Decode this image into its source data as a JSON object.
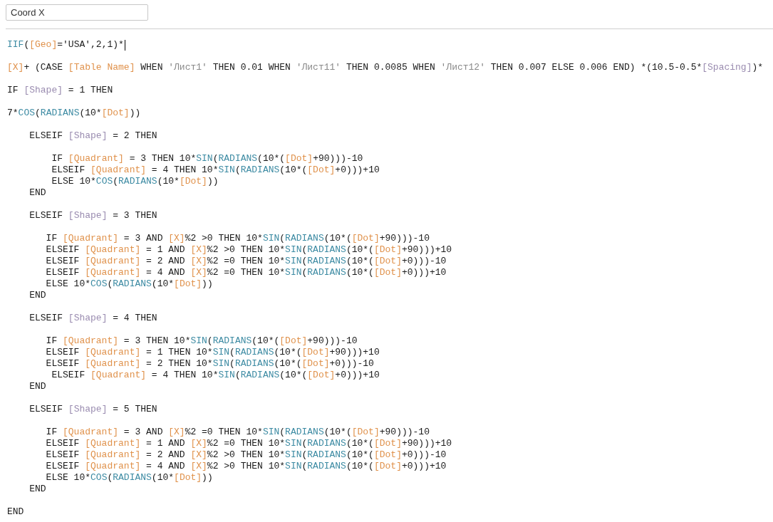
{
  "name_field": {
    "value": "Coord X"
  },
  "code_blocks": [
    [
      {
        "cursor": true,
        "tokens": [
          {
            "kind": "function",
            "text": "IIF"
          },
          {
            "kind": "plain",
            "text": "("
          },
          {
            "kind": "field",
            "text": "[Geo]"
          },
          {
            "kind": "plain",
            "text": "='USA',2,1)*"
          }
        ]
      }
    ],
    [
      {
        "cursor": false,
        "tokens": [
          {
            "kind": "field",
            "text": "[X]"
          },
          {
            "kind": "plain",
            "text": "+ (CASE "
          },
          {
            "kind": "field",
            "text": "[Table Name]"
          },
          {
            "kind": "plain",
            "text": " WHEN "
          },
          {
            "kind": "string",
            "text": "'Лист1'"
          },
          {
            "kind": "plain",
            "text": " THEN 0.01 WHEN "
          },
          {
            "kind": "string",
            "text": "'Лист11'"
          },
          {
            "kind": "plain",
            "text": " THEN 0.0085 WHEN "
          },
          {
            "kind": "string",
            "text": "'Лист12'"
          },
          {
            "kind": "plain",
            "text": " THEN 0.007 ELSE 0.006 END) *(10.5-0.5*"
          },
          {
            "kind": "parameter",
            "text": "[Spacing]"
          },
          {
            "kind": "plain",
            "text": ")*"
          }
        ]
      }
    ],
    [
      {
        "cursor": false,
        "tokens": [
          {
            "kind": "plain",
            "text": "IF "
          },
          {
            "kind": "parameter",
            "text": "[Shape]"
          },
          {
            "kind": "plain",
            "text": " = 1 THEN"
          }
        ]
      }
    ],
    [
      {
        "cursor": false,
        "tokens": [
          {
            "kind": "plain",
            "text": "7*"
          },
          {
            "kind": "function",
            "text": "COS"
          },
          {
            "kind": "plain",
            "text": "("
          },
          {
            "kind": "function",
            "text": "RADIANS"
          },
          {
            "kind": "plain",
            "text": "(10*"
          },
          {
            "kind": "field",
            "text": "[Dot]"
          },
          {
            "kind": "plain",
            "text": "))"
          }
        ]
      }
    ],
    [
      {
        "cursor": false,
        "tokens": [
          {
            "kind": "plain",
            "text": "    ELSEIF "
          },
          {
            "kind": "parameter",
            "text": "[Shape]"
          },
          {
            "kind": "plain",
            "text": " = 2 THEN"
          }
        ]
      }
    ],
    [
      {
        "cursor": false,
        "tokens": [
          {
            "kind": "plain",
            "text": "        IF "
          },
          {
            "kind": "field",
            "text": "[Quadrant]"
          },
          {
            "kind": "plain",
            "text": " = 3 THEN 10*"
          },
          {
            "kind": "function",
            "text": "SIN"
          },
          {
            "kind": "plain",
            "text": "("
          },
          {
            "kind": "function",
            "text": "RADIANS"
          },
          {
            "kind": "plain",
            "text": "(10*("
          },
          {
            "kind": "field",
            "text": "[Dot]"
          },
          {
            "kind": "plain",
            "text": "+90)))-10"
          }
        ]
      },
      {
        "cursor": false,
        "tokens": [
          {
            "kind": "plain",
            "text": "        ELSEIF "
          },
          {
            "kind": "field",
            "text": "[Quadrant]"
          },
          {
            "kind": "plain",
            "text": " = 4 THEN 10*"
          },
          {
            "kind": "function",
            "text": "SIN"
          },
          {
            "kind": "plain",
            "text": "("
          },
          {
            "kind": "function",
            "text": "RADIANS"
          },
          {
            "kind": "plain",
            "text": "(10*("
          },
          {
            "kind": "field",
            "text": "[Dot]"
          },
          {
            "kind": "plain",
            "text": "+0)))+10"
          }
        ]
      },
      {
        "cursor": false,
        "tokens": [
          {
            "kind": "plain",
            "text": "        ELSE 10*"
          },
          {
            "kind": "function",
            "text": "COS"
          },
          {
            "kind": "plain",
            "text": "("
          },
          {
            "kind": "function",
            "text": "RADIANS"
          },
          {
            "kind": "plain",
            "text": "(10*"
          },
          {
            "kind": "field",
            "text": "[Dot]"
          },
          {
            "kind": "plain",
            "text": "))"
          }
        ]
      },
      {
        "cursor": false,
        "tokens": [
          {
            "kind": "plain",
            "text": "    END"
          }
        ]
      }
    ],
    [
      {
        "cursor": false,
        "tokens": [
          {
            "kind": "plain",
            "text": "    ELSEIF "
          },
          {
            "kind": "parameter",
            "text": "[Shape]"
          },
          {
            "kind": "plain",
            "text": " = 3 THEN"
          }
        ]
      }
    ],
    [
      {
        "cursor": false,
        "tokens": [
          {
            "kind": "plain",
            "text": "       IF "
          },
          {
            "kind": "field",
            "text": "[Quadrant]"
          },
          {
            "kind": "plain",
            "text": " = 3 AND "
          },
          {
            "kind": "field",
            "text": "[X]"
          },
          {
            "kind": "plain",
            "text": "%2 >0 THEN 10*"
          },
          {
            "kind": "function",
            "text": "SIN"
          },
          {
            "kind": "plain",
            "text": "("
          },
          {
            "kind": "function",
            "text": "RADIANS"
          },
          {
            "kind": "plain",
            "text": "(10*("
          },
          {
            "kind": "field",
            "text": "[Dot]"
          },
          {
            "kind": "plain",
            "text": "+90)))-10"
          }
        ]
      },
      {
        "cursor": false,
        "tokens": [
          {
            "kind": "plain",
            "text": "       ELSEIF "
          },
          {
            "kind": "field",
            "text": "[Quadrant]"
          },
          {
            "kind": "plain",
            "text": " = 1 AND "
          },
          {
            "kind": "field",
            "text": "[X]"
          },
          {
            "kind": "plain",
            "text": "%2 >0 THEN 10*"
          },
          {
            "kind": "function",
            "text": "SIN"
          },
          {
            "kind": "plain",
            "text": "("
          },
          {
            "kind": "function",
            "text": "RADIANS"
          },
          {
            "kind": "plain",
            "text": "(10*("
          },
          {
            "kind": "field",
            "text": "[Dot]"
          },
          {
            "kind": "plain",
            "text": "+90)))+10"
          }
        ]
      },
      {
        "cursor": false,
        "tokens": [
          {
            "kind": "plain",
            "text": "       ELSEIF "
          },
          {
            "kind": "field",
            "text": "[Quadrant]"
          },
          {
            "kind": "plain",
            "text": " = 2 AND "
          },
          {
            "kind": "field",
            "text": "[X]"
          },
          {
            "kind": "plain",
            "text": "%2 =0 THEN 10*"
          },
          {
            "kind": "function",
            "text": "SIN"
          },
          {
            "kind": "plain",
            "text": "("
          },
          {
            "kind": "function",
            "text": "RADIANS"
          },
          {
            "kind": "plain",
            "text": "(10*("
          },
          {
            "kind": "field",
            "text": "[Dot]"
          },
          {
            "kind": "plain",
            "text": "+0)))-10"
          }
        ]
      },
      {
        "cursor": false,
        "tokens": [
          {
            "kind": "plain",
            "text": "       ELSEIF "
          },
          {
            "kind": "field",
            "text": "[Quadrant]"
          },
          {
            "kind": "plain",
            "text": " = 4 AND "
          },
          {
            "kind": "field",
            "text": "[X]"
          },
          {
            "kind": "plain",
            "text": "%2 =0 THEN 10*"
          },
          {
            "kind": "function",
            "text": "SIN"
          },
          {
            "kind": "plain",
            "text": "("
          },
          {
            "kind": "function",
            "text": "RADIANS"
          },
          {
            "kind": "plain",
            "text": "(10*("
          },
          {
            "kind": "field",
            "text": "[Dot]"
          },
          {
            "kind": "plain",
            "text": "+0)))+10"
          }
        ]
      },
      {
        "cursor": false,
        "tokens": [
          {
            "kind": "plain",
            "text": "       ELSE 10*"
          },
          {
            "kind": "function",
            "text": "COS"
          },
          {
            "kind": "plain",
            "text": "("
          },
          {
            "kind": "function",
            "text": "RADIANS"
          },
          {
            "kind": "plain",
            "text": "(10*"
          },
          {
            "kind": "field",
            "text": "[Dot]"
          },
          {
            "kind": "plain",
            "text": "))"
          }
        ]
      },
      {
        "cursor": false,
        "tokens": [
          {
            "kind": "plain",
            "text": "    END"
          }
        ]
      }
    ],
    [
      {
        "cursor": false,
        "tokens": [
          {
            "kind": "plain",
            "text": "    ELSEIF "
          },
          {
            "kind": "parameter",
            "text": "[Shape]"
          },
          {
            "kind": "plain",
            "text": " = 4 THEN"
          }
        ]
      }
    ],
    [
      {
        "cursor": false,
        "tokens": [
          {
            "kind": "plain",
            "text": "       IF "
          },
          {
            "kind": "field",
            "text": "[Quadrant]"
          },
          {
            "kind": "plain",
            "text": " = 3 THEN 10*"
          },
          {
            "kind": "function",
            "text": "SIN"
          },
          {
            "kind": "plain",
            "text": "("
          },
          {
            "kind": "function",
            "text": "RADIANS"
          },
          {
            "kind": "plain",
            "text": "(10*("
          },
          {
            "kind": "field",
            "text": "[Dot]"
          },
          {
            "kind": "plain",
            "text": "+90)))-10"
          }
        ]
      },
      {
        "cursor": false,
        "tokens": [
          {
            "kind": "plain",
            "text": "       ELSEIF "
          },
          {
            "kind": "field",
            "text": "[Quadrant]"
          },
          {
            "kind": "plain",
            "text": " = 1 THEN 10*"
          },
          {
            "kind": "function",
            "text": "SIN"
          },
          {
            "kind": "plain",
            "text": "("
          },
          {
            "kind": "function",
            "text": "RADIANS"
          },
          {
            "kind": "plain",
            "text": "(10*("
          },
          {
            "kind": "field",
            "text": "[Dot]"
          },
          {
            "kind": "plain",
            "text": "+90)))+10"
          }
        ]
      },
      {
        "cursor": false,
        "tokens": [
          {
            "kind": "plain",
            "text": "       ELSEIF "
          },
          {
            "kind": "field",
            "text": "[Quadrant]"
          },
          {
            "kind": "plain",
            "text": " = 2 THEN 10*"
          },
          {
            "kind": "function",
            "text": "SIN"
          },
          {
            "kind": "plain",
            "text": "("
          },
          {
            "kind": "function",
            "text": "RADIANS"
          },
          {
            "kind": "plain",
            "text": "(10*("
          },
          {
            "kind": "field",
            "text": "[Dot]"
          },
          {
            "kind": "plain",
            "text": "+0)))-10"
          }
        ]
      },
      {
        "cursor": false,
        "tokens": [
          {
            "kind": "plain",
            "text": "        ELSEIF "
          },
          {
            "kind": "field",
            "text": "[Quadrant]"
          },
          {
            "kind": "plain",
            "text": " = 4 THEN 10*"
          },
          {
            "kind": "function",
            "text": "SIN"
          },
          {
            "kind": "plain",
            "text": "("
          },
          {
            "kind": "function",
            "text": "RADIANS"
          },
          {
            "kind": "plain",
            "text": "(10*("
          },
          {
            "kind": "field",
            "text": "[Dot]"
          },
          {
            "kind": "plain",
            "text": "+0)))+10"
          }
        ]
      },
      {
        "cursor": false,
        "tokens": [
          {
            "kind": "plain",
            "text": "    END"
          }
        ]
      }
    ],
    [
      {
        "cursor": false,
        "tokens": [
          {
            "kind": "plain",
            "text": "    ELSEIF "
          },
          {
            "kind": "parameter",
            "text": "[Shape]"
          },
          {
            "kind": "plain",
            "text": " = 5 THEN"
          }
        ]
      }
    ],
    [
      {
        "cursor": false,
        "tokens": [
          {
            "kind": "plain",
            "text": "       IF "
          },
          {
            "kind": "field",
            "text": "[Quadrant]"
          },
          {
            "kind": "plain",
            "text": " = 3 AND "
          },
          {
            "kind": "field",
            "text": "[X]"
          },
          {
            "kind": "plain",
            "text": "%2 =0 THEN 10*"
          },
          {
            "kind": "function",
            "text": "SIN"
          },
          {
            "kind": "plain",
            "text": "("
          },
          {
            "kind": "function",
            "text": "RADIANS"
          },
          {
            "kind": "plain",
            "text": "(10*("
          },
          {
            "kind": "field",
            "text": "[Dot]"
          },
          {
            "kind": "plain",
            "text": "+90)))-10"
          }
        ]
      },
      {
        "cursor": false,
        "tokens": [
          {
            "kind": "plain",
            "text": "       ELSEIF "
          },
          {
            "kind": "field",
            "text": "[Quadrant]"
          },
          {
            "kind": "plain",
            "text": " = 1 AND "
          },
          {
            "kind": "field",
            "text": "[X]"
          },
          {
            "kind": "plain",
            "text": "%2 =0 THEN 10*"
          },
          {
            "kind": "function",
            "text": "SIN"
          },
          {
            "kind": "plain",
            "text": "("
          },
          {
            "kind": "function",
            "text": "RADIANS"
          },
          {
            "kind": "plain",
            "text": "(10*("
          },
          {
            "kind": "field",
            "text": "[Dot]"
          },
          {
            "kind": "plain",
            "text": "+90)))+10"
          }
        ]
      },
      {
        "cursor": false,
        "tokens": [
          {
            "kind": "plain",
            "text": "       ELSEIF "
          },
          {
            "kind": "field",
            "text": "[Quadrant]"
          },
          {
            "kind": "plain",
            "text": " = 2 AND "
          },
          {
            "kind": "field",
            "text": "[X]"
          },
          {
            "kind": "plain",
            "text": "%2 >0 THEN 10*"
          },
          {
            "kind": "function",
            "text": "SIN"
          },
          {
            "kind": "plain",
            "text": "("
          },
          {
            "kind": "function",
            "text": "RADIANS"
          },
          {
            "kind": "plain",
            "text": "(10*("
          },
          {
            "kind": "field",
            "text": "[Dot]"
          },
          {
            "kind": "plain",
            "text": "+0)))-10"
          }
        ]
      },
      {
        "cursor": false,
        "tokens": [
          {
            "kind": "plain",
            "text": "       ELSEIF "
          },
          {
            "kind": "field",
            "text": "[Quadrant]"
          },
          {
            "kind": "plain",
            "text": " = 4 AND "
          },
          {
            "kind": "field",
            "text": "[X]"
          },
          {
            "kind": "plain",
            "text": "%2 >0 THEN 10*"
          },
          {
            "kind": "function",
            "text": "SIN"
          },
          {
            "kind": "plain",
            "text": "("
          },
          {
            "kind": "function",
            "text": "RADIANS"
          },
          {
            "kind": "plain",
            "text": "(10*("
          },
          {
            "kind": "field",
            "text": "[Dot]"
          },
          {
            "kind": "plain",
            "text": "+0)))+10"
          }
        ]
      },
      {
        "cursor": false,
        "tokens": [
          {
            "kind": "plain",
            "text": "       ELSE 10*"
          },
          {
            "kind": "function",
            "text": "COS"
          },
          {
            "kind": "plain",
            "text": "("
          },
          {
            "kind": "function",
            "text": "RADIANS"
          },
          {
            "kind": "plain",
            "text": "(10*"
          },
          {
            "kind": "field",
            "text": "[Dot]"
          },
          {
            "kind": "plain",
            "text": "))"
          }
        ]
      },
      {
        "cursor": false,
        "tokens": [
          {
            "kind": "plain",
            "text": "    END"
          }
        ]
      }
    ],
    [
      {
        "cursor": false,
        "tokens": [
          {
            "kind": "plain",
            "text": "END"
          }
        ]
      }
    ]
  ]
}
